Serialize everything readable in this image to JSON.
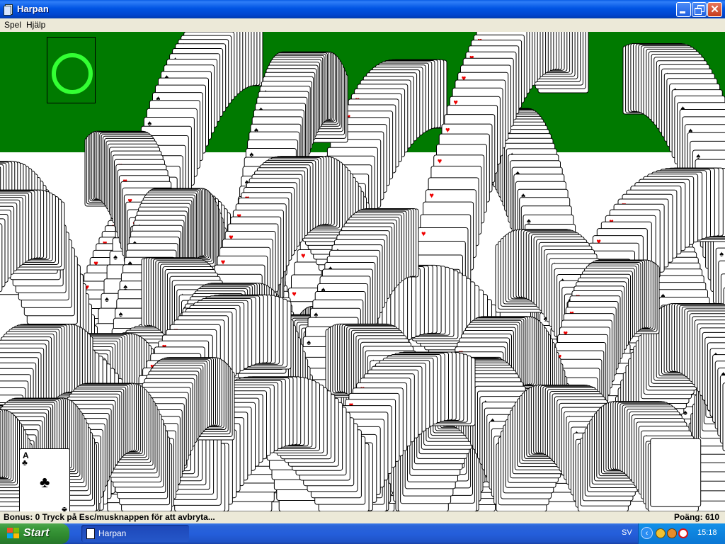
{
  "window": {
    "title": "Harpan",
    "minimize_icon": "minimize-icon",
    "maximize_icon": "restore-icon",
    "close_icon": "close-icon",
    "close_glyph": "✕"
  },
  "menu": [
    {
      "label": "Spel"
    },
    {
      "label": "Hjälp"
    }
  ],
  "game": {
    "felt_color": "#007a00",
    "foundation_ring_color": "#33ff33",
    "card": {
      "rank": "A",
      "suit": "♣",
      "suit_name": "clubs"
    }
  },
  "status": {
    "left_text": "Bonus: 0  Tryck på Esc/musknappen för att avbryta...",
    "score_text": "Poäng: 610"
  },
  "taskbar": {
    "start_label": "Start",
    "task_label": "Harpan",
    "language": "SV",
    "tray_chevron": "‹",
    "clock": "15:18"
  }
}
